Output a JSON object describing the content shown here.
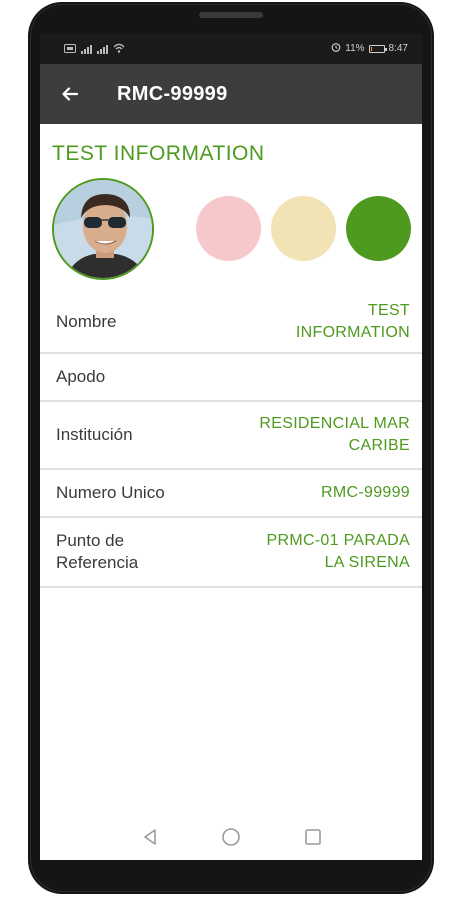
{
  "status_bar": {
    "battery_percent": "11%",
    "battery_level": 0.11,
    "time": "8:47",
    "icons": [
      "sim-icon",
      "signal-icon",
      "signal-icon",
      "wifi-icon",
      "alarm-icon",
      "battery-icon"
    ]
  },
  "app_bar": {
    "title": "RMC-99999",
    "back_icon": "arrow-left-icon"
  },
  "profile": {
    "section_title": "TEST INFORMATION",
    "status_colors": [
      "#f6c8cc",
      "#f1e3b4",
      "#4e9a1f"
    ]
  },
  "fields": [
    {
      "label": "Nombre",
      "value_lines": [
        "TEST",
        "INFORMATION"
      ]
    },
    {
      "label": "Apodo",
      "value_lines": []
    },
    {
      "label": "Institución",
      "value_lines": [
        "RESIDENCIAL MAR",
        "CARIBE"
      ]
    },
    {
      "label": "Numero Unico",
      "value_lines": [
        "RMC-99999"
      ]
    },
    {
      "label_lines": [
        "Punto de",
        "Referencia"
      ],
      "value_lines": [
        "PRMC-01 PARADA",
        "LA SIRENA"
      ]
    }
  ],
  "nav_bar": {
    "icons": [
      "back-triangle-icon",
      "home-circle-icon",
      "recents-square-icon"
    ]
  },
  "colors": {
    "accent": "#4e9a1f",
    "app_bar": "#3d3d3d",
    "status_bar": "#1b1b1b"
  }
}
